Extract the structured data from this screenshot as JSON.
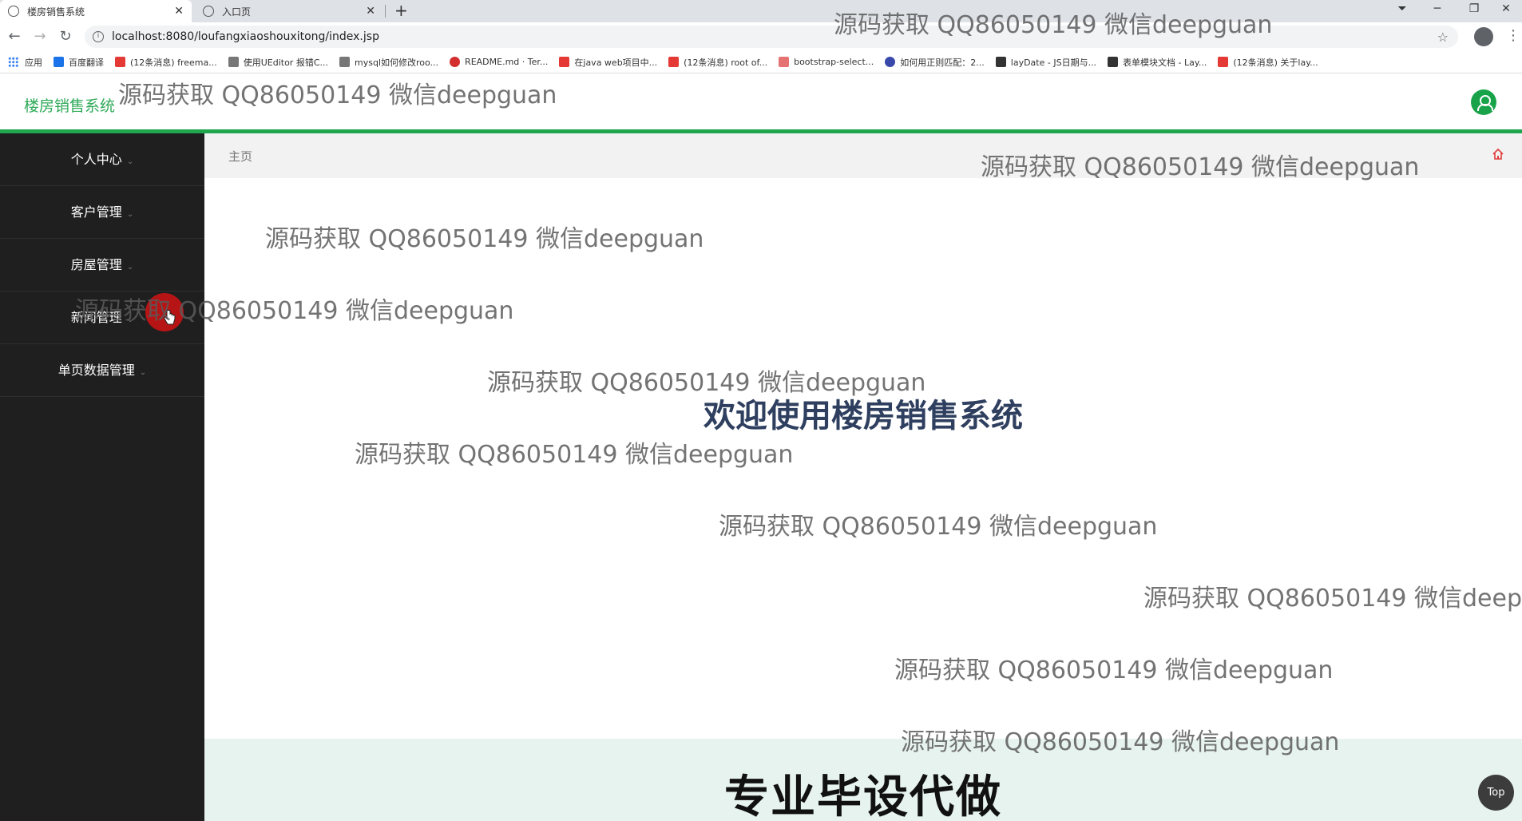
{
  "browser": {
    "tabs": [
      {
        "title": "楼房销售系统",
        "active": true
      },
      {
        "title": "入口页",
        "active": false
      }
    ],
    "url": "localhost:8080/loufangxiaoshouxitong/index.jsp",
    "bookmarks": [
      {
        "label": "应用",
        "color": ""
      },
      {
        "label": "百度翻译",
        "color": "#1a73e8"
      },
      {
        "label": "(12条消息) freema...",
        "color": "#e53935"
      },
      {
        "label": "使用UEditor 报错C...",
        "color": "#777777"
      },
      {
        "label": "mysql如何修改roo...",
        "color": "#777777"
      },
      {
        "label": "README.md · Ter...",
        "color": "#d32f2f"
      },
      {
        "label": "在java web项目中...",
        "color": "#e53935"
      },
      {
        "label": "(12条消息) root of...",
        "color": "#e53935"
      },
      {
        "label": "bootstrap-select...",
        "color": "#e57373"
      },
      {
        "label": "如何用正则匹配：2...",
        "color": "#3949ab"
      },
      {
        "label": "layDate - JS日期与...",
        "color": "#333333"
      },
      {
        "label": "表单模块文档 - Lay...",
        "color": "#333333"
      },
      {
        "label": "(12条消息) 关于lay...",
        "color": "#e53935"
      }
    ]
  },
  "app": {
    "logo": "楼房销售系统",
    "breadcrumb": "主页",
    "welcome": "欢迎使用楼房销售系统",
    "banner": "专业毕设代做",
    "top_button": "Top",
    "accent_color": "#1fa64f"
  },
  "sidebar": {
    "items": [
      {
        "label": "个人中心"
      },
      {
        "label": "客户管理"
      },
      {
        "label": "房屋管理"
      },
      {
        "label": "新闻管理"
      },
      {
        "label": "单页数据管理"
      }
    ]
  },
  "watermark": "源码获取 QQ86050149 微信deepguan"
}
